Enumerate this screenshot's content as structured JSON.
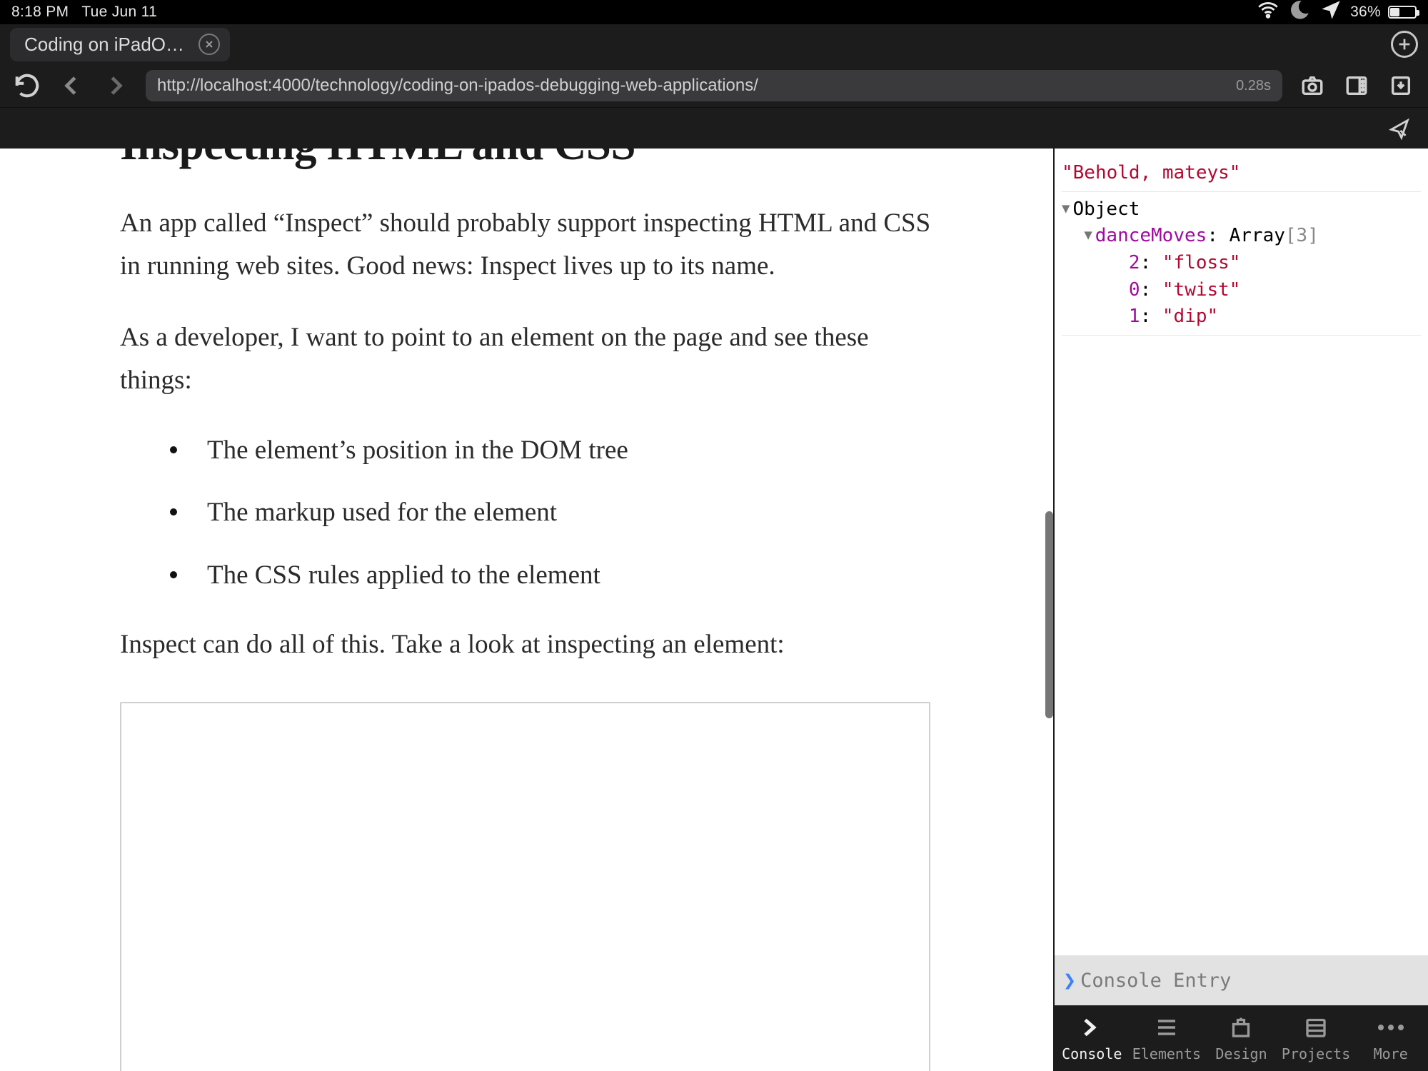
{
  "status": {
    "time": "8:18 PM",
    "date": "Tue Jun 11",
    "battery_pct": "36%"
  },
  "tab": {
    "title": "Coding on iPadOS: D…"
  },
  "toolbar": {
    "url": "http://localhost:4000/technology/coding-on-ipados-debugging-web-applications/",
    "timing": "0.28s"
  },
  "article": {
    "heading": "Inspecting HTML and CSS",
    "p1": "An app called “Inspect” should probably support inspecting HTML and CSS in running web sites. Good news: Inspect lives up to its name.",
    "p2": "As a developer, I want to point to an element on the page and see these things:",
    "li1": "The element’s position in the DOM tree",
    "li2": "The markup used for the element",
    "li3": "The CSS rules applied to the element",
    "p3": "Inspect can do all of this. Take a look at inspecting an element:"
  },
  "console": {
    "log1": "\"Behold, mateys\"",
    "obj_label": "Object",
    "arr_key": "danceMoves",
    "arr_type": "Array",
    "arr_len": "[3]",
    "items": [
      {
        "idx": "2",
        "val": "\"floss\""
      },
      {
        "idx": "0",
        "val": "\"twist\""
      },
      {
        "idx": "1",
        "val": "\"dip\""
      }
    ],
    "input_placeholder": "Console Entry"
  },
  "devtabs": {
    "console": "Console",
    "elements": "Elements",
    "design": "Design",
    "projects": "Projects",
    "more": "More"
  }
}
